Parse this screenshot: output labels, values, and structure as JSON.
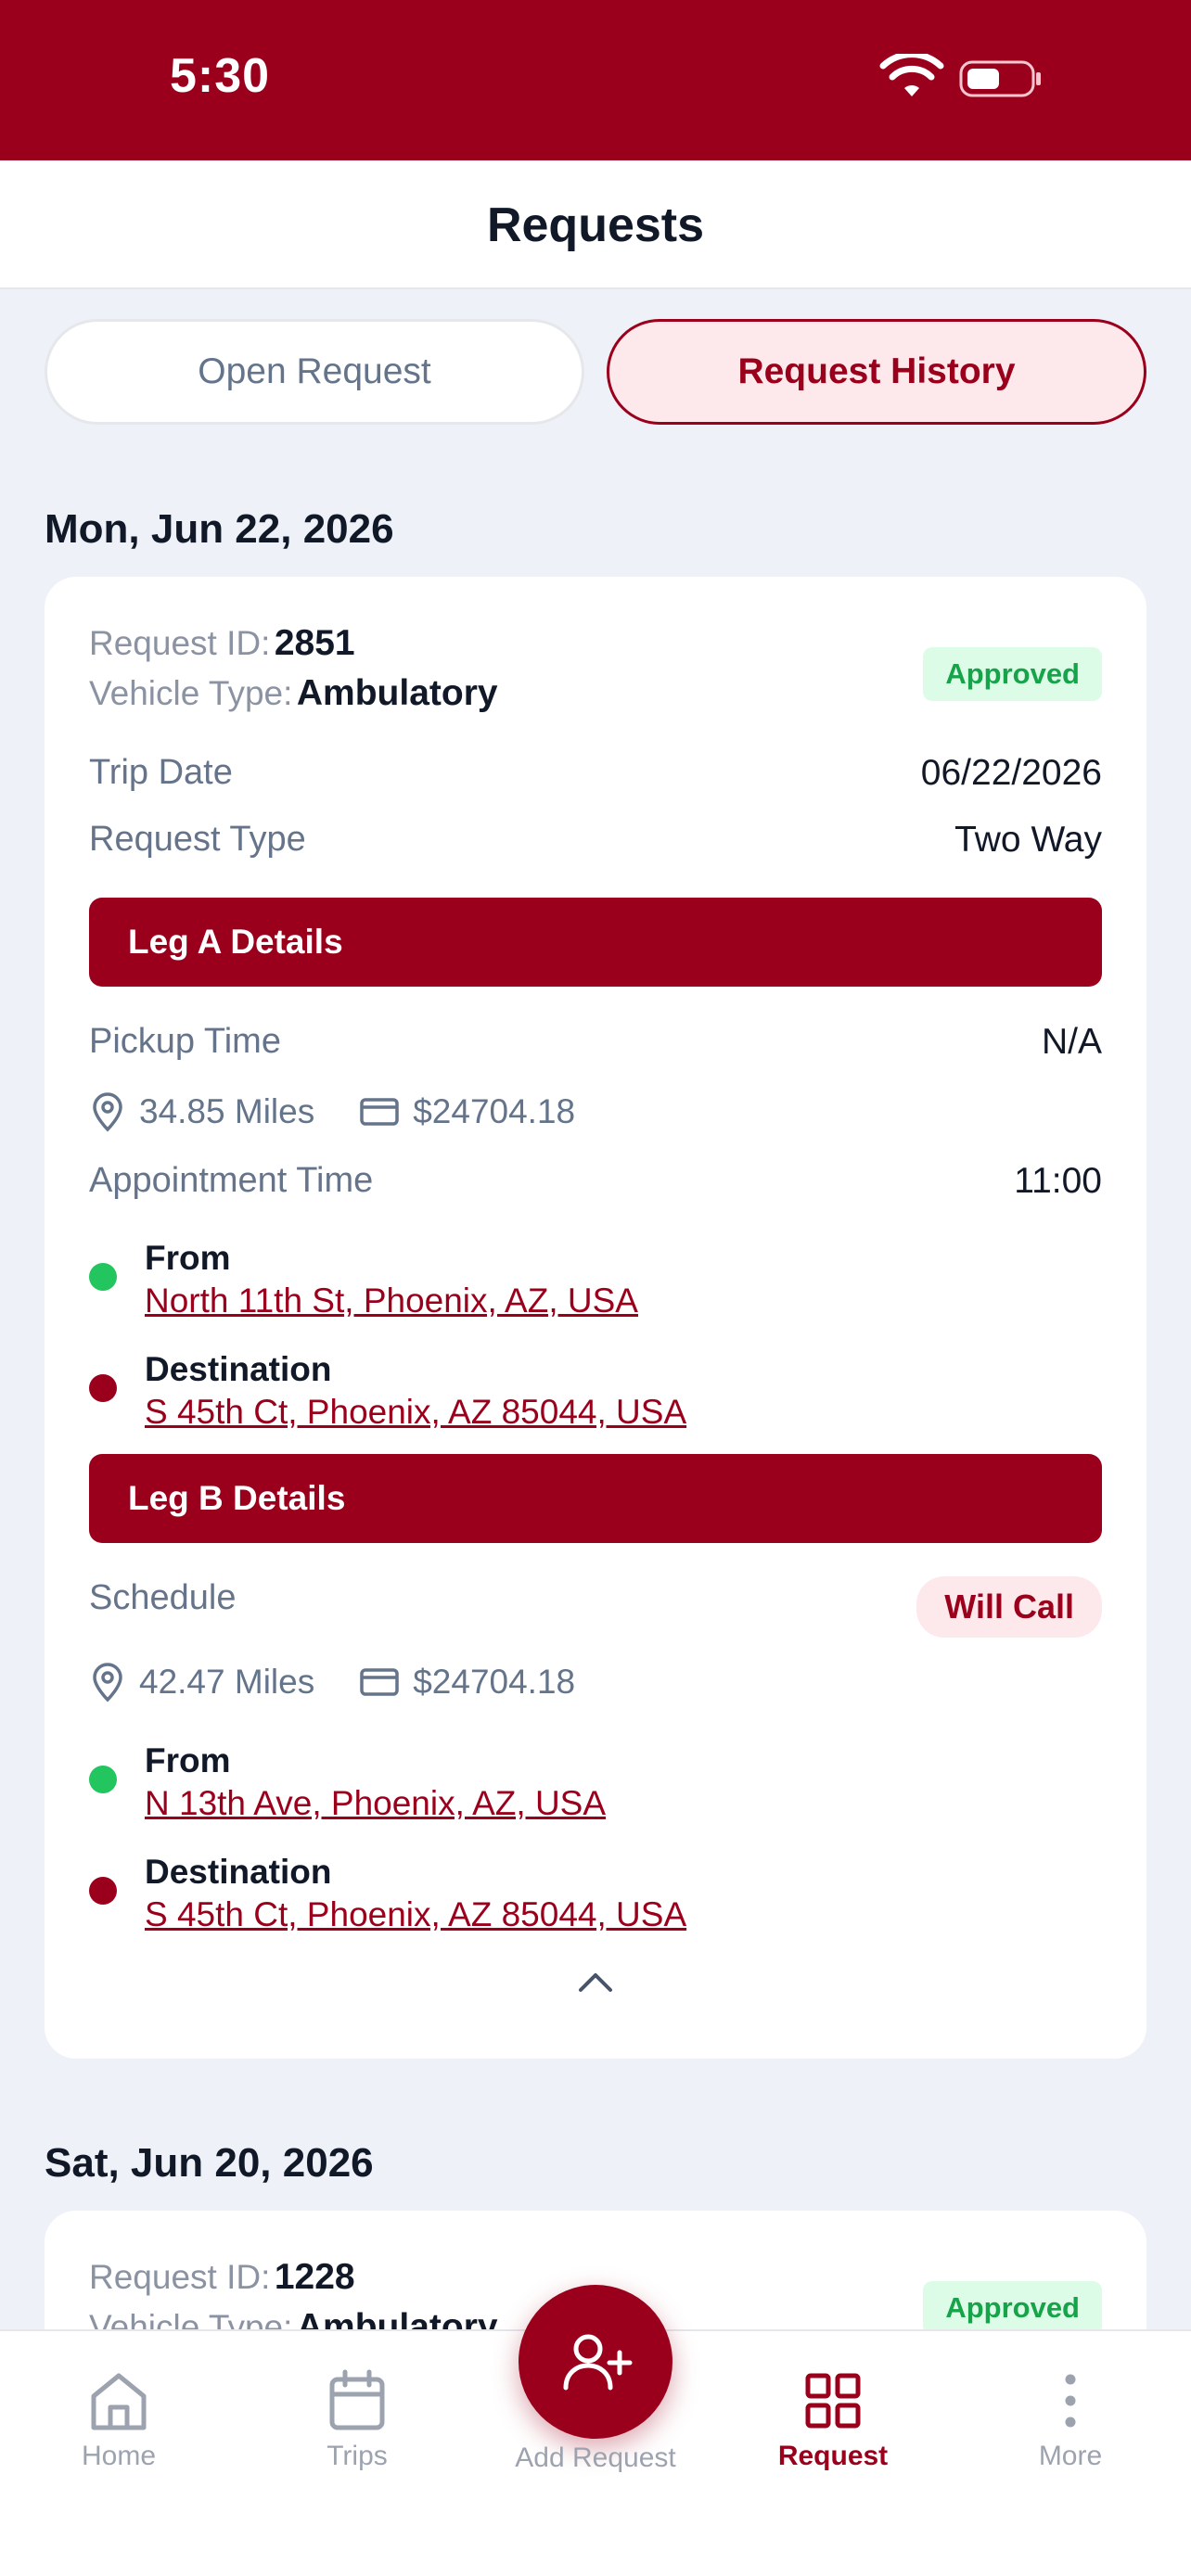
{
  "status_bar": {
    "time": "5:30"
  },
  "header": {
    "title": "Requests"
  },
  "tabs": {
    "open": "Open Request",
    "history": "Request History"
  },
  "groups": [
    {
      "date": "Mon, Jun 22, 2026",
      "request": {
        "id_label": "Request ID:",
        "id": "2851",
        "vehicle_label": "Vehicle Type:",
        "vehicle": "Ambulatory",
        "status": "Approved",
        "trip_date_label": "Trip Date",
        "trip_date": "06/22/2026",
        "request_type_label": "Request Type",
        "request_type": "Two Way",
        "leg_a": {
          "title": "Leg A Details",
          "pickup_label": "Pickup Time",
          "pickup": "N/A",
          "miles": "34.85 Miles",
          "cost": "$24704.18",
          "appointment_label": "Appointment Time",
          "appointment": "11:00",
          "from_label": "From",
          "from": "North 11th St, Phoenix, AZ, USA",
          "destination_label": "Destination",
          "destination": "S 45th Ct, Phoenix, AZ 85044, USA"
        },
        "leg_b": {
          "title": "Leg B Details",
          "schedule_label": "Schedule",
          "schedule": "Will Call",
          "miles": "42.47 Miles",
          "cost": "$24704.18",
          "from_label": "From",
          "from": "N 13th Ave, Phoenix, AZ, USA",
          "destination_label": "Destination",
          "destination": "S 45th Ct, Phoenix, AZ 85044, USA"
        }
      }
    },
    {
      "date": "Sat, Jun 20, 2026",
      "request": {
        "id_label": "Request ID:",
        "id": "1228",
        "vehicle_label": "Vehicle Type:",
        "vehicle": "Ambulatory",
        "status": "Approved"
      }
    }
  ],
  "nav": {
    "home": "Home",
    "trips": "Trips",
    "add_request": "Add Request",
    "request": "Request",
    "more": "More"
  },
  "colors": {
    "brand": "#9a001c",
    "approved": "#16a34a",
    "from_dot": "#22c55e"
  },
  "icons": [
    "wifi-icon",
    "battery-icon",
    "location-pin-icon",
    "card-icon",
    "chevron-up-icon",
    "home-icon",
    "calendar-icon",
    "add-user-icon",
    "grid-icon",
    "more-vertical-icon"
  ]
}
